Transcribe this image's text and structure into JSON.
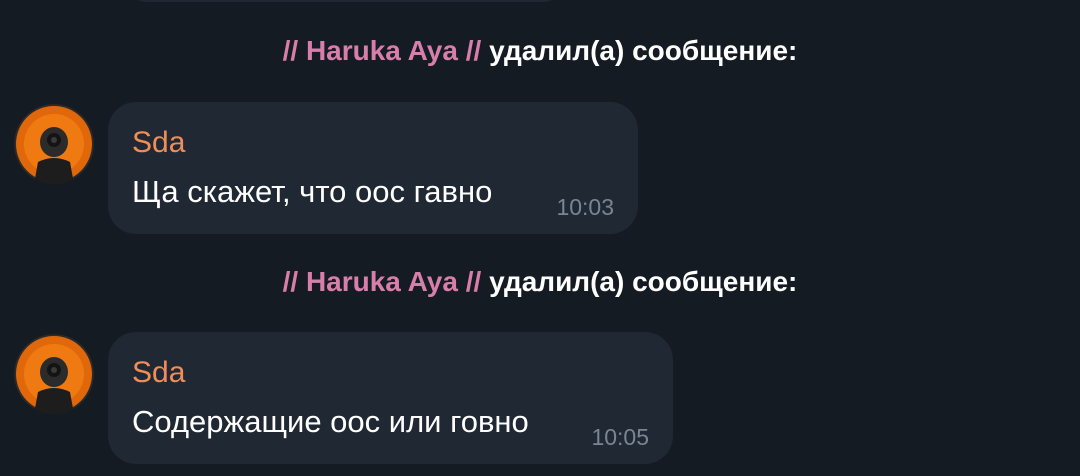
{
  "events": [
    {
      "prefix": "//",
      "name": "Haruka Aya",
      "suffix": "//",
      "action": "удалил(а) сообщение:"
    },
    {
      "prefix": "//",
      "name": "Haruka Aya",
      "suffix": "//",
      "action": "удалил(а) сообщение:"
    }
  ],
  "messages": [
    {
      "sender": "Sda",
      "text": "Ща скажет, что оос гавно",
      "time": "10:03"
    },
    {
      "sender": "Sda",
      "text": "Содержащие оос или говно",
      "time": "10:05"
    }
  ],
  "colors": {
    "background": "#151b23",
    "bubble": "#1f2833",
    "service_name": "#d77fa9",
    "sender_name": "#f08d58",
    "time": "#7a8591"
  }
}
